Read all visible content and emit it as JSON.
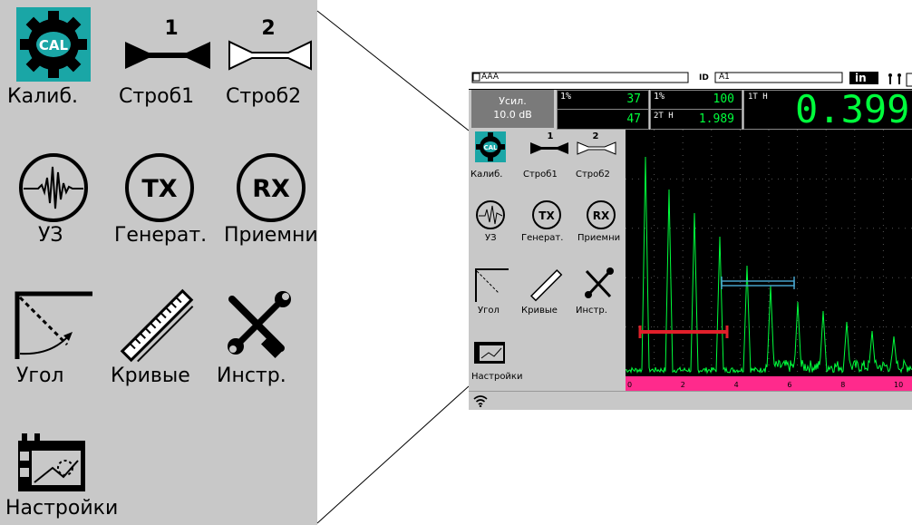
{
  "zoom_menu": {
    "items": [
      {
        "label": "Калиб.",
        "icon": "cal-gear-icon"
      },
      {
        "label": "Строб1",
        "icon": "gate1-icon"
      },
      {
        "label": "Строб2",
        "icon": "gate2-icon"
      },
      {
        "label": "УЗ",
        "icon": "ultrasound-waveform-icon"
      },
      {
        "label": "Генерат.",
        "icon": "tx-generator-icon"
      },
      {
        "label": "Приемни",
        "icon": "rx-receiver-icon"
      },
      {
        "label": "Угол",
        "icon": "angle-icon"
      },
      {
        "label": "Кривые",
        "icon": "curves-ruler-icon"
      },
      {
        "label": "Инстр.",
        "icon": "tools-icon"
      },
      {
        "label": "Настройки",
        "icon": "settings-display-icon"
      }
    ],
    "cal_text": "CAL",
    "gate1_number": "1",
    "gate2_number": "2",
    "tx_text": "TX",
    "rx_text": "RX"
  },
  "device": {
    "file_name": "AAA",
    "id_label": "ID",
    "id_value": "A1",
    "unit": "in",
    "gain_label": "Усил.",
    "gain_value": "10.0 dB",
    "readouts": {
      "r1_label": "1%",
      "r1_value": "37",
      "r2_value": "47",
      "r3_label": "1%",
      "r3_value": "100",
      "r4_label": "2T H",
      "r4_value": "1.989",
      "r5_label": "1T H",
      "big_value": "0.399"
    },
    "axis_ticks": [
      "0",
      "2",
      "4",
      "6",
      "8",
      "10"
    ]
  },
  "colors": {
    "accent_green": "#00ff3c",
    "cal_teal": "#1aa6a6",
    "gate1_red": "#e0202a",
    "gate2_cyan": "#46a0c8",
    "axis_pink": "#ff2a8c",
    "panel_gray": "#c8c8c8"
  }
}
